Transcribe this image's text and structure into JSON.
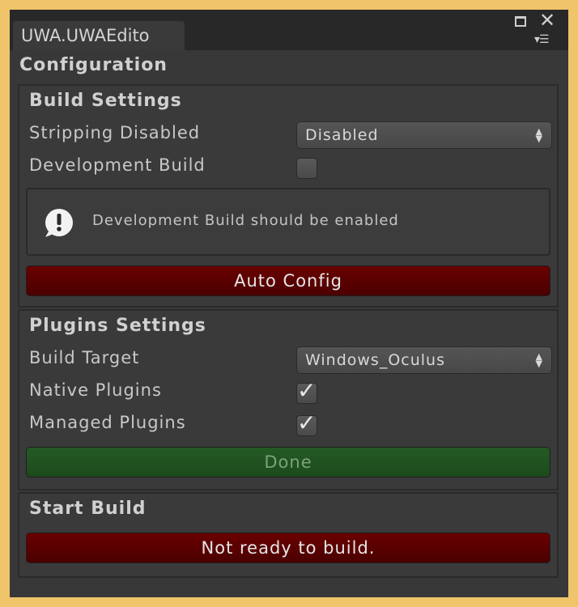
{
  "window": {
    "tab_title": "UWA.UWAEdito",
    "title": "Configuration"
  },
  "build_settings": {
    "heading": "Build Settings",
    "stripping_label": "Stripping Disabled",
    "stripping_value": "Disabled",
    "development_label": "Development Build",
    "development_checked": false,
    "help_text": "Development Build should be enabled",
    "auto_config_label": "Auto Config"
  },
  "plugins_settings": {
    "heading": "Plugins Settings",
    "build_target_label": "Build Target",
    "build_target_value": "Windows_Oculus",
    "native_label": "Native Plugins",
    "native_checked": true,
    "managed_label": "Managed Plugins",
    "managed_checked": true,
    "done_label": "Done"
  },
  "start_build": {
    "heading": "Start Build",
    "status_button_label": "Not ready to build."
  },
  "colors": {
    "frame": "#efc46a",
    "panel": "#383838",
    "button_red": "#5a0000",
    "button_green": "#215321"
  },
  "icons": [
    "maximize-icon",
    "close-icon",
    "menu-icon",
    "warning-icon",
    "dropdown-arrows-icon",
    "checkmark-icon"
  ]
}
